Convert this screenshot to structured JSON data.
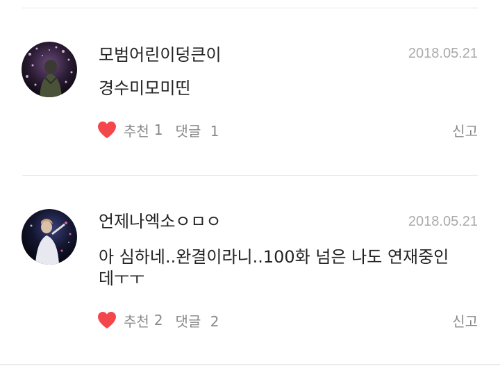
{
  "comments": [
    {
      "nickname": "모범어린이덩큰이",
      "date": "2018.05.21",
      "text": "경수미모미띤",
      "like_label": "추천",
      "like_count": "1",
      "reply_label": "댓글",
      "reply_count": "1",
      "report_label": "신고",
      "avatar_icon": "profile-photo"
    },
    {
      "nickname": "언제나엑소ㅇㅁㅇ",
      "date": "2018.05.21",
      "text": "아 심하네..완결이라니..100화 넘은 나도 연재중인데ㅜㅜ",
      "like_label": "추천",
      "like_count": "2",
      "reply_label": "댓글",
      "reply_count": "2",
      "report_label": "신고",
      "avatar_icon": "profile-photo"
    }
  ],
  "colors": {
    "heart": "#f4474b",
    "meta_text": "#888888",
    "date_text": "#aaaaaa",
    "divider": "#e6e6e6"
  }
}
